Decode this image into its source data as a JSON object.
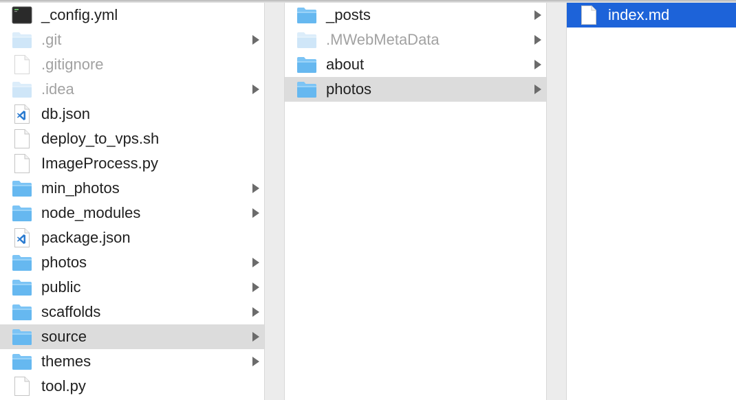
{
  "columns": [
    {
      "name": "project-root",
      "items": [
        {
          "label": "_config.yml",
          "icon": "terminal-icon",
          "has_children": false,
          "hidden": false,
          "selected": false
        },
        {
          "label": ".git",
          "icon": "folder-icon",
          "has_children": true,
          "hidden": true,
          "selected": false
        },
        {
          "label": ".gitignore",
          "icon": "document-icon",
          "has_children": false,
          "hidden": true,
          "selected": false
        },
        {
          "label": ".idea",
          "icon": "folder-icon",
          "has_children": true,
          "hidden": true,
          "selected": false
        },
        {
          "label": "db.json",
          "icon": "vscode-document-icon",
          "has_children": false,
          "hidden": false,
          "selected": false
        },
        {
          "label": "deploy_to_vps.sh",
          "icon": "document-icon",
          "has_children": false,
          "hidden": false,
          "selected": false
        },
        {
          "label": "ImageProcess.py",
          "icon": "document-icon",
          "has_children": false,
          "hidden": false,
          "selected": false
        },
        {
          "label": "min_photos",
          "icon": "folder-icon",
          "has_children": true,
          "hidden": false,
          "selected": false
        },
        {
          "label": "node_modules",
          "icon": "folder-icon",
          "has_children": true,
          "hidden": false,
          "selected": false
        },
        {
          "label": "package.json",
          "icon": "vscode-document-icon",
          "has_children": false,
          "hidden": false,
          "selected": false
        },
        {
          "label": "photos",
          "icon": "folder-icon",
          "has_children": true,
          "hidden": false,
          "selected": false
        },
        {
          "label": "public",
          "icon": "folder-icon",
          "has_children": true,
          "hidden": false,
          "selected": false
        },
        {
          "label": "scaffolds",
          "icon": "folder-icon",
          "has_children": true,
          "hidden": false,
          "selected": false
        },
        {
          "label": "source",
          "icon": "folder-icon",
          "has_children": true,
          "hidden": false,
          "selected": "gray"
        },
        {
          "label": "themes",
          "icon": "folder-icon",
          "has_children": true,
          "hidden": false,
          "selected": false
        },
        {
          "label": "tool.py",
          "icon": "document-icon",
          "has_children": false,
          "hidden": false,
          "selected": false
        }
      ]
    },
    {
      "name": "source",
      "items": [
        {
          "label": "_posts",
          "icon": "folder-icon",
          "has_children": true,
          "hidden": false,
          "selected": false
        },
        {
          "label": ".MWebMetaData",
          "icon": "folder-icon",
          "has_children": true,
          "hidden": true,
          "selected": false
        },
        {
          "label": "about",
          "icon": "folder-icon",
          "has_children": true,
          "hidden": false,
          "selected": false
        },
        {
          "label": "photos",
          "icon": "folder-icon",
          "has_children": true,
          "hidden": false,
          "selected": "gray"
        }
      ]
    },
    {
      "name": "photos",
      "items": [
        {
          "label": "index.md",
          "icon": "document-icon",
          "has_children": false,
          "hidden": false,
          "selected": "blue"
        }
      ]
    }
  ],
  "colors": {
    "folder_body": "#66b8f0",
    "folder_tab": "#7cc4f5",
    "selection_blue": "#1d63d9",
    "selection_gray": "#dcdcdc",
    "hidden_text": "#a2a2a2"
  }
}
